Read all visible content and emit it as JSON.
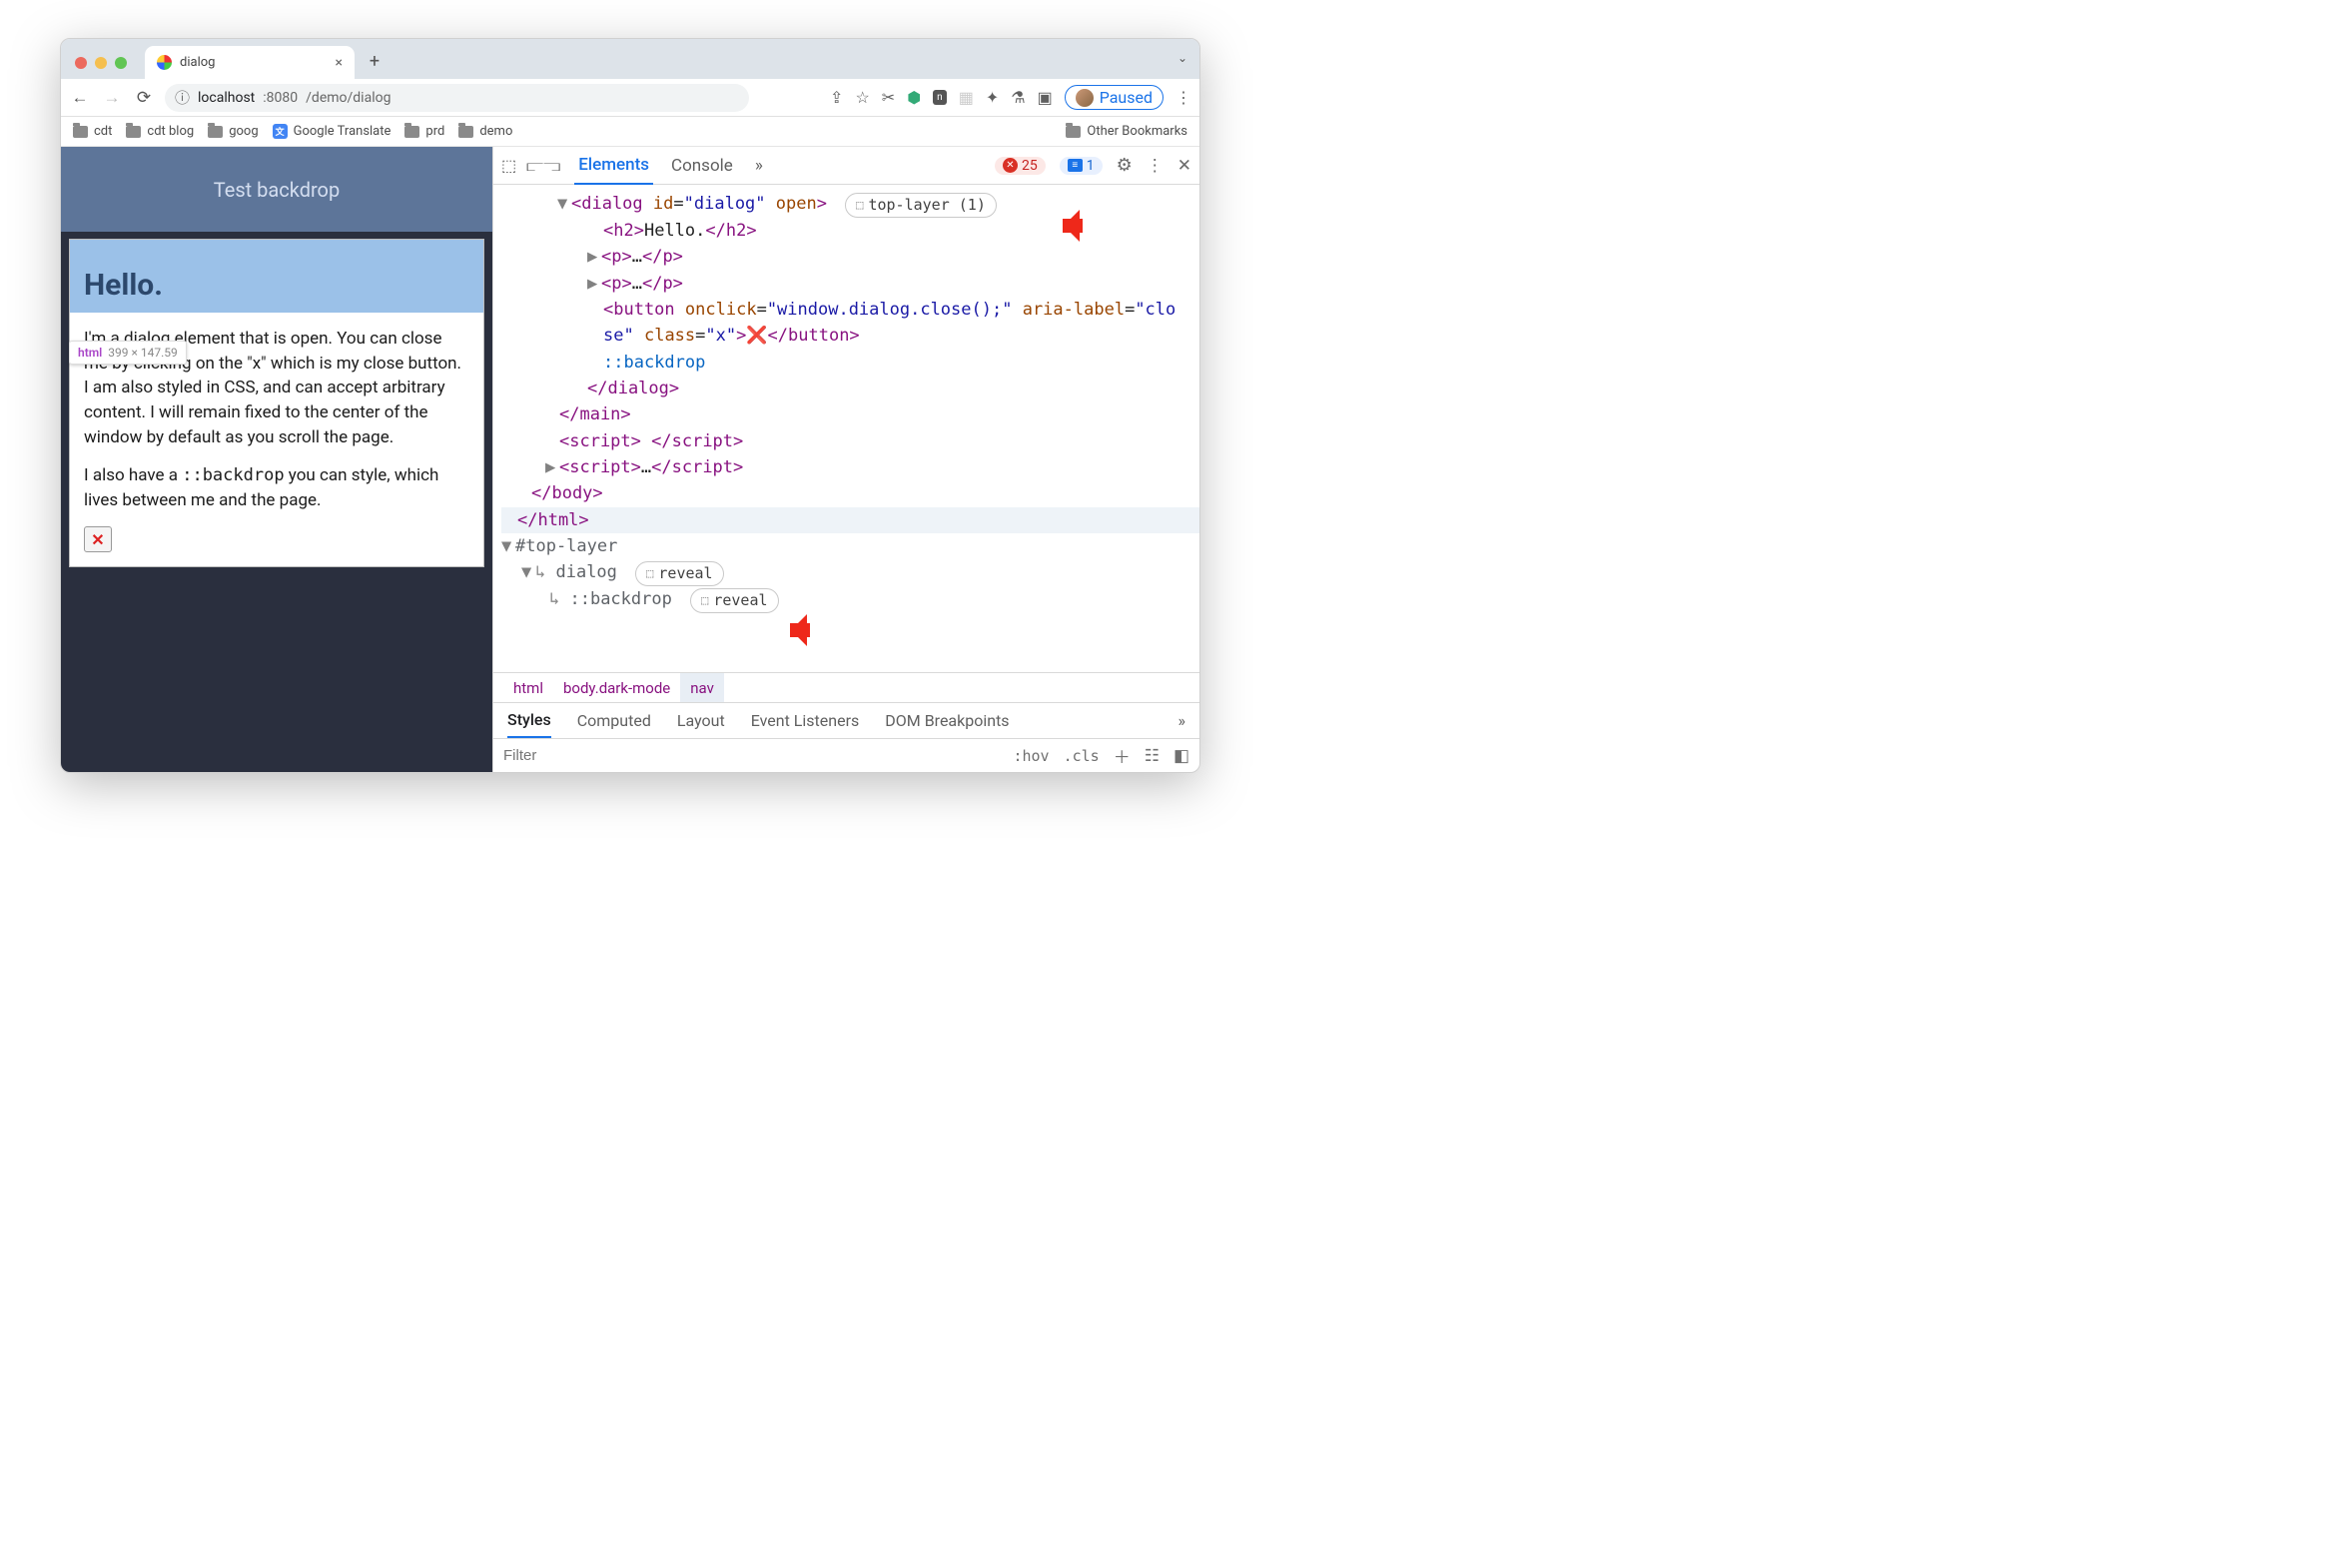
{
  "browser": {
    "tab_title": "dialog",
    "tab_close": "×",
    "url_host": "localhost",
    "url_port": ":8080",
    "url_path": "/demo/dialog",
    "paused": "Paused",
    "bookmarks": [
      "cdt",
      "cdt blog",
      "goog",
      "Google Translate",
      "prd",
      "demo"
    ],
    "other_bookmarks": "Other Bookmarks"
  },
  "page": {
    "header": "Test backdrop",
    "h2": "Hello.",
    "tooltip_label": "html",
    "tooltip_dims": "399 × 147.59",
    "p1": "I'm a dialog element that is open. You can close me by clicking on the \"x\" which is my close button. I am also styled in CSS, and can accept arbitrary content. I will remain fixed to the center of the window by default as you scroll the page.",
    "p2_a": "I also have a ",
    "p2_code": "::backdrop",
    "p2_b": " you can style, which lives between me and the page.",
    "x": "✕"
  },
  "dt": {
    "tabs": {
      "elements": "Elements",
      "console": "Console",
      "more": "»"
    },
    "err_count": "25",
    "msg_count": "1",
    "badge_top": "top-layer (1)",
    "reveal": "reveal",
    "code": {
      "dialog_open": "<dialog id=\"dialog\" open>",
      "h2": "Hello.",
      "p": "…",
      "button_seg1": "<button onclick=\"window.dialog.close();\" aria-label=\"clo",
      "button_seg2": "se\" class=\"x\">",
      "button_emoji": "❌",
      "button_close": "</button>",
      "pseudo": "::backdrop",
      "dialog_close": "</dialog>",
      "main_close": "</main>",
      "script_empty": "<script> </script>",
      "script_dots": "<script>…</script>",
      "body_close": "</body>",
      "html_close": "</html>",
      "top_layer": "#top-layer",
      "dialog_word": "dialog",
      "backdrop_word": "::backdrop"
    },
    "crumbs": {
      "html": "html",
      "body": "body.dark-mode",
      "nav": "nav"
    },
    "styletabs": [
      "Styles",
      "Computed",
      "Layout",
      "Event Listeners",
      "DOM Breakpoints",
      "»"
    ],
    "filter_placeholder": "Filter",
    "hov": ":hov",
    "cls": ".cls"
  }
}
